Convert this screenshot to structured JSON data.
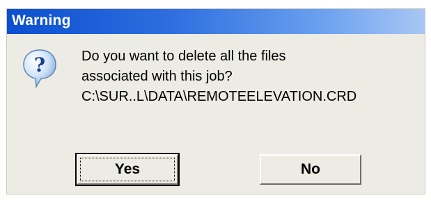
{
  "window": {
    "title": "Warning"
  },
  "icons": {
    "message_icon": "question-icon",
    "icon_colors": {
      "balloon": "#cfe3f7",
      "mark": "#1b3f8f"
    }
  },
  "message": {
    "lines": [
      "Do you want to delete all the files",
      "associated with this job?",
      "C:\\SUR..L\\DATA\\REMOTEELEVATION.CRD"
    ]
  },
  "buttons": {
    "yes_label": "Yes",
    "no_label": "No",
    "default": "Yes"
  },
  "colors": {
    "titlebar_start": "#0b4fcf",
    "titlebar_end": "#a9c7f5",
    "dialog_background": "#ecebe4"
  }
}
